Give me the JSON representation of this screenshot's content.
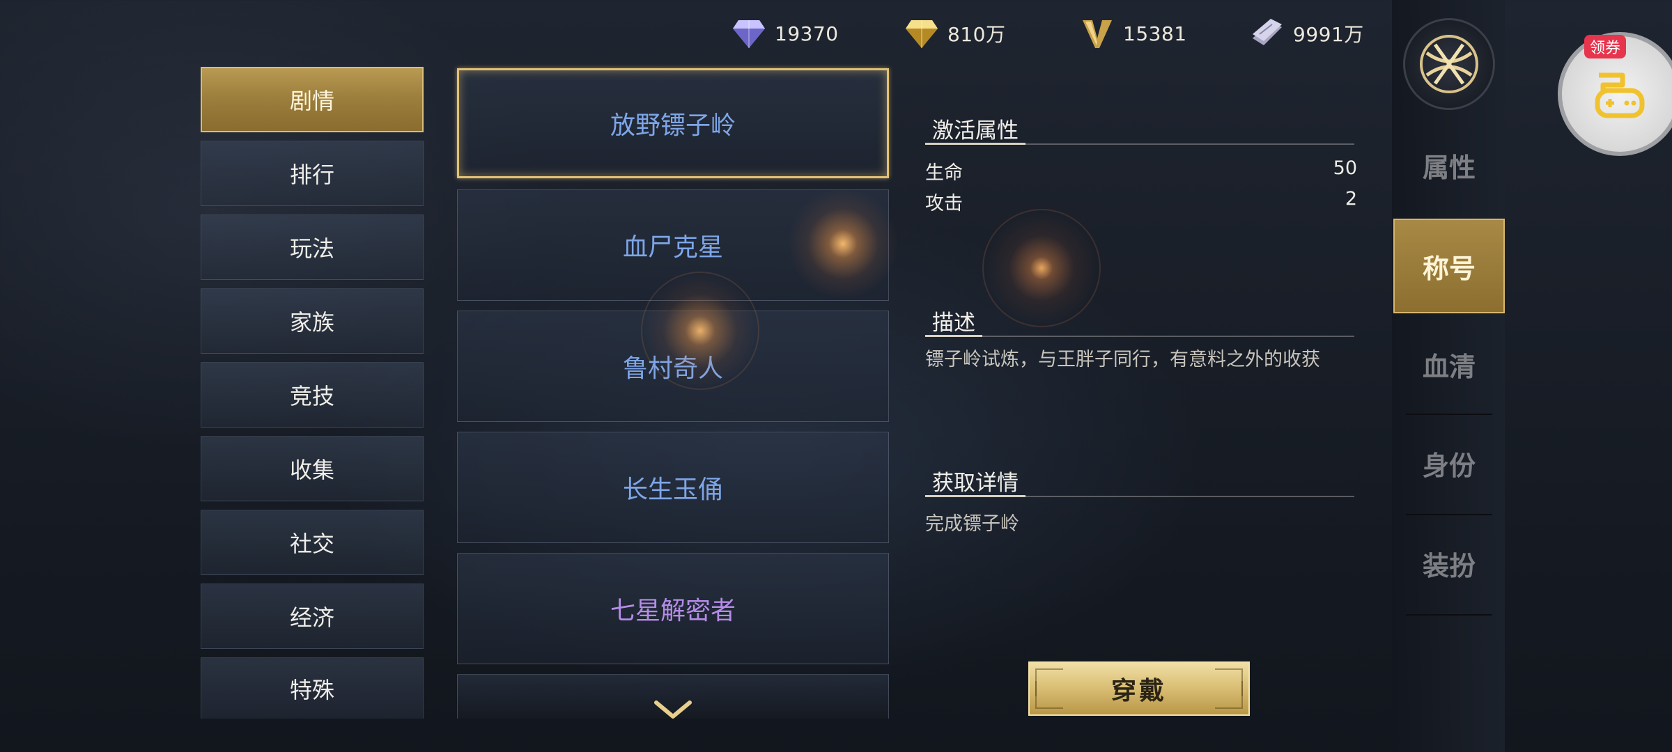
{
  "currencies": [
    {
      "icon": "purple-diamond-icon",
      "amount": "19370"
    },
    {
      "icon": "gold-diamond-icon",
      "amount": "810万"
    },
    {
      "icon": "v-coin-icon",
      "amount": "15381"
    },
    {
      "icon": "silver-ticket-icon",
      "amount": "9991万"
    }
  ],
  "categories": [
    {
      "label": "剧情",
      "active": true
    },
    {
      "label": "排行",
      "active": false
    },
    {
      "label": "玩法",
      "active": false
    },
    {
      "label": "家族",
      "active": false
    },
    {
      "label": "竞技",
      "active": false
    },
    {
      "label": "收集",
      "active": false
    },
    {
      "label": "社交",
      "active": false
    },
    {
      "label": "经济",
      "active": false
    },
    {
      "label": "特殊",
      "active": false
    }
  ],
  "titles": [
    {
      "label": "放野镖子岭",
      "color": "#7ea6e8",
      "selected": true
    },
    {
      "label": "血尸克星",
      "color": "#7ea6e8",
      "selected": false
    },
    {
      "label": "鲁村奇人",
      "color": "#7ea6e8",
      "selected": false
    },
    {
      "label": "长生玉俑",
      "color": "#7ea6e8",
      "selected": false
    },
    {
      "label": "七星解密者",
      "color": "#b58ce8",
      "selected": false
    }
  ],
  "detail": {
    "attributes_heading": "激活属性",
    "stats": [
      {
        "name": "生命",
        "value": "50"
      },
      {
        "name": "攻击",
        "value": "2"
      }
    ],
    "description_heading": "描述",
    "description": "镖子岭试炼，与王胖子同行，有意料之外的收获",
    "acquire_heading": "获取详情",
    "acquire_text": "完成镖子岭"
  },
  "equip_button": "穿戴",
  "side_tabs": [
    {
      "label": "属性",
      "active": false
    },
    {
      "label": "称号",
      "active": true
    },
    {
      "label": "血清",
      "active": false
    },
    {
      "label": "身份",
      "active": false
    },
    {
      "label": "装扮",
      "active": false
    }
  ],
  "coupon_badge": "领券",
  "colors": {
    "gold_accent": "#e2c175",
    "title_blue": "#7ea6e8",
    "title_purple": "#b58ce8",
    "badge_red": "#e7354d"
  }
}
